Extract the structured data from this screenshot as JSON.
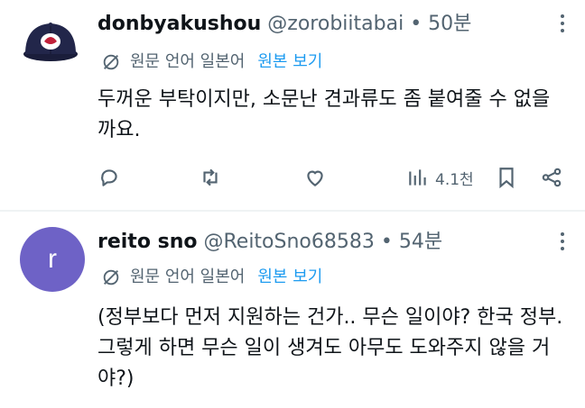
{
  "tweets": [
    {
      "name": "donbyakushou",
      "handle": "@zorobiitabai",
      "dot": "•",
      "time": "50분",
      "translate_label": "원문 언어 일본어",
      "show_original": "원본 보기",
      "text": "두꺼운 부탁이지만, 소문난 견과류도 좀 붙여줄 수 없을까요.",
      "views": "4.1천"
    },
    {
      "name": "reito sno",
      "handle": "@ReitoSno68583",
      "dot": "•",
      "time": "54분",
      "avatar_letter": "r",
      "translate_label": "원문 언어 일본어",
      "show_original": "원본 보기",
      "text": "(정부보다 먼저 지원하는 건가.. 무슨 일이야? 한국 정부. 그렇게 하면 무슨 일이 생겨도 아무도 도와주지 않을 거야?)"
    }
  ],
  "colors": {
    "accent": "#1d9bf0",
    "secondary": "#536471",
    "text": "#0f1419",
    "avatar_bg": "#6e62c6"
  },
  "icons": [
    "reply-icon",
    "retweet-icon",
    "like-icon",
    "views-icon",
    "bookmark-icon",
    "share-icon",
    "translate-icon",
    "more-icon"
  ]
}
